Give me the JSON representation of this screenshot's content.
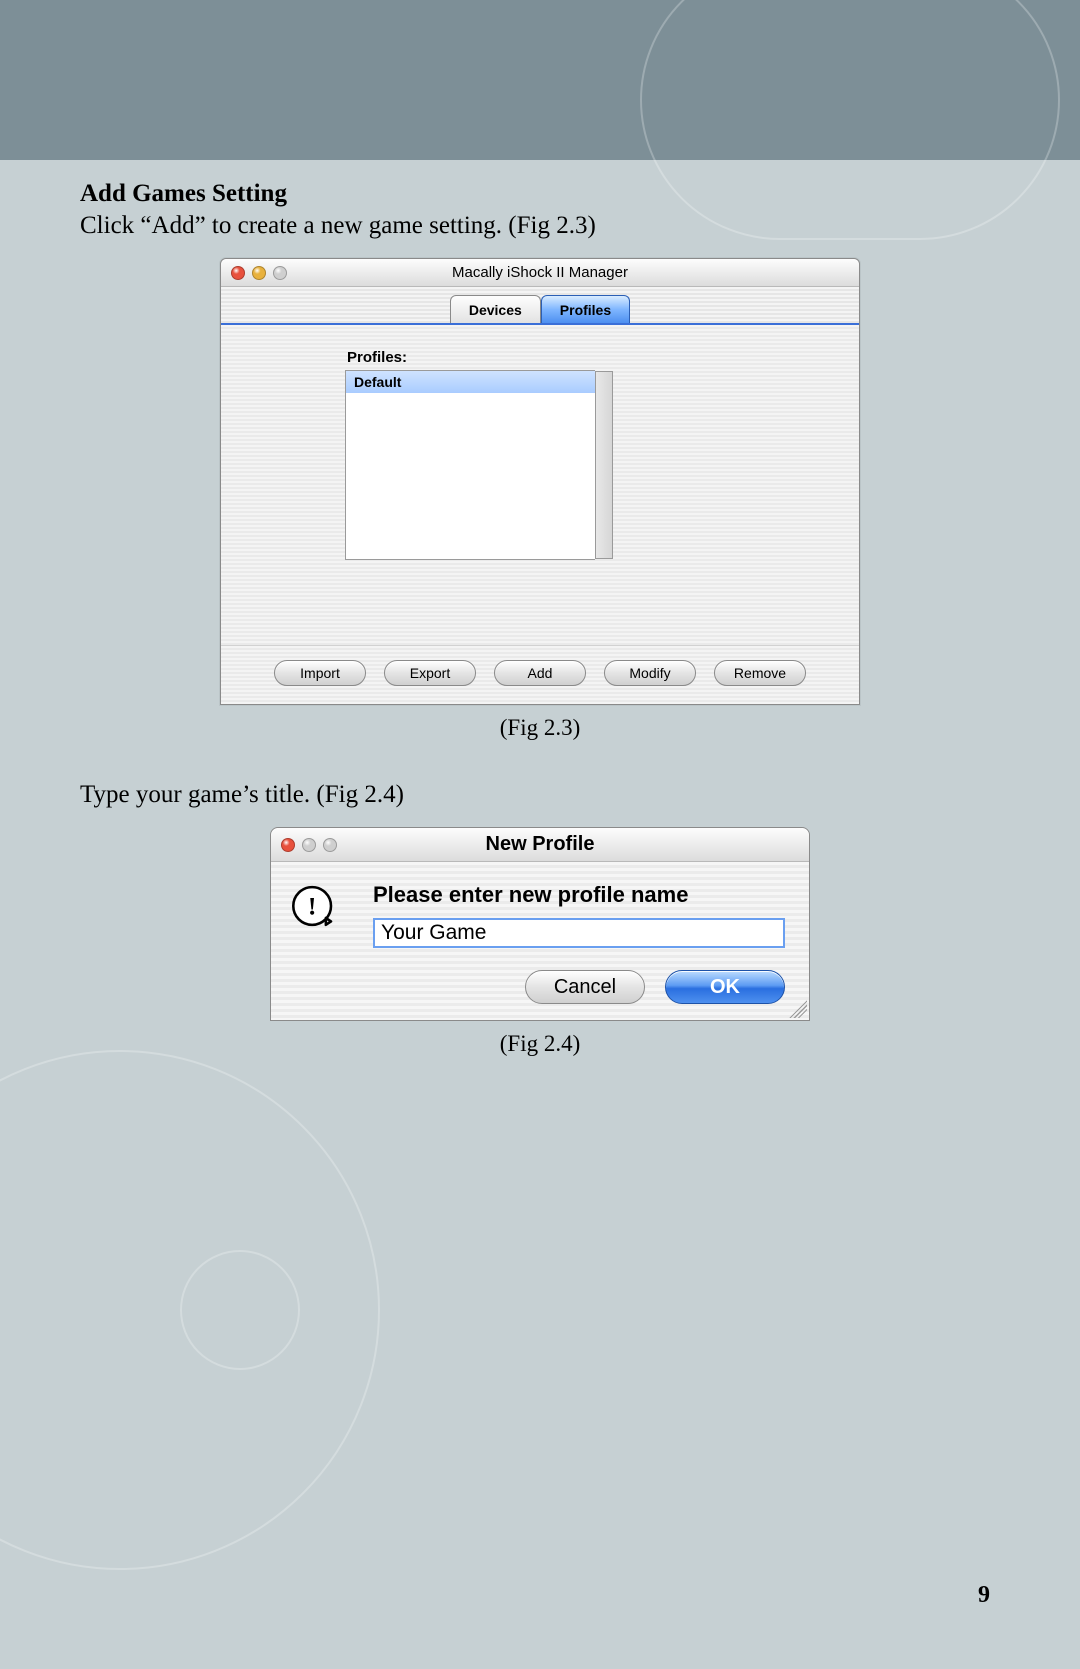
{
  "doc": {
    "heading": "Add Games Setting",
    "intro": "Click “Add” to create a new game setting. (Fig 2.3)",
    "fig23_caption": "(Fig 2.3)",
    "step2": "Type your game’s title. (Fig 2.4)",
    "fig24_caption": "(Fig 2.4)",
    "page_number": "9"
  },
  "fig23": {
    "window_title": "Macally iShock II Manager",
    "tabs": {
      "devices": "Devices",
      "profiles": "Profiles"
    },
    "profiles_label": "Profiles:",
    "profiles_items": [
      "Default"
    ],
    "buttons": {
      "import": "Import",
      "export": "Export",
      "add": "Add",
      "modify": "Modify",
      "remove": "Remove"
    }
  },
  "fig24": {
    "window_title": "New Profile",
    "prompt": "Please enter new profile name",
    "input_value": "Your Game",
    "buttons": {
      "cancel": "Cancel",
      "ok": "OK"
    }
  }
}
